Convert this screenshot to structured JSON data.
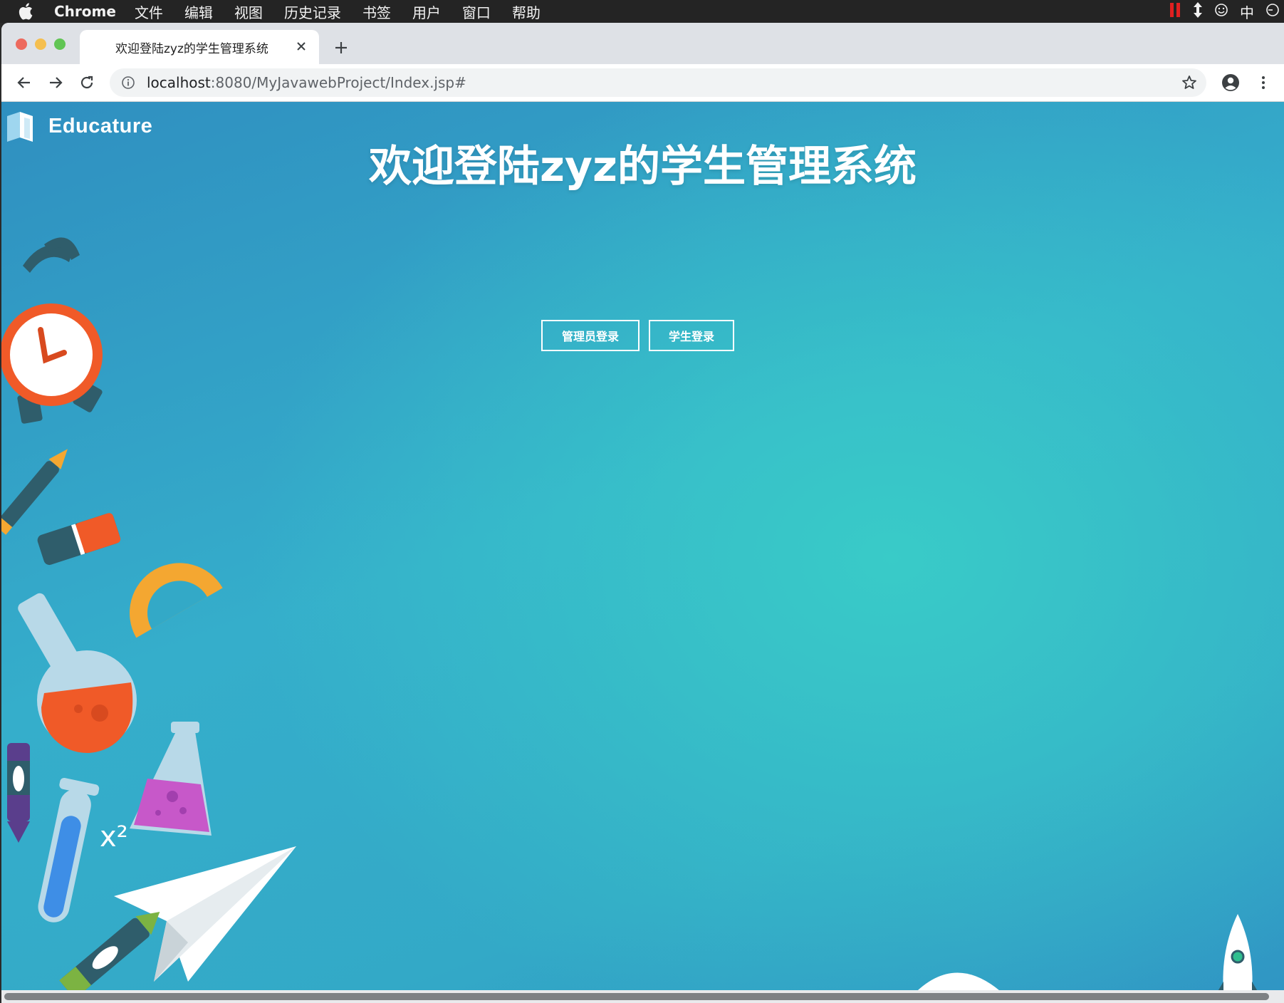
{
  "menubar": {
    "app": "Chrome",
    "items": [
      "文件",
      "编辑",
      "视图",
      "历史记录",
      "书签",
      "用户",
      "窗口",
      "帮助"
    ],
    "ime": "中"
  },
  "tab": {
    "title": "欢迎登陆zyz的学生管理系统"
  },
  "address": {
    "host": "localhost",
    "path": ":8080/MyJavawebProject/Index.jsp#"
  },
  "page": {
    "brand": "Educature",
    "headline": "欢迎登陆zyz的学生管理系统",
    "buttons": {
      "admin": "管理员登录",
      "student": "学生登录"
    },
    "decor_text": "x²"
  },
  "colors": {
    "accent": "#35b7c9",
    "button_border": "#ffffff"
  },
  "icons": [
    "apple-icon",
    "back-arrow-icon",
    "forward-arrow-icon",
    "reload-icon",
    "info-icon",
    "star-icon",
    "account-icon",
    "more-icon",
    "close-icon",
    "plus-icon",
    "rocket-icon"
  ]
}
